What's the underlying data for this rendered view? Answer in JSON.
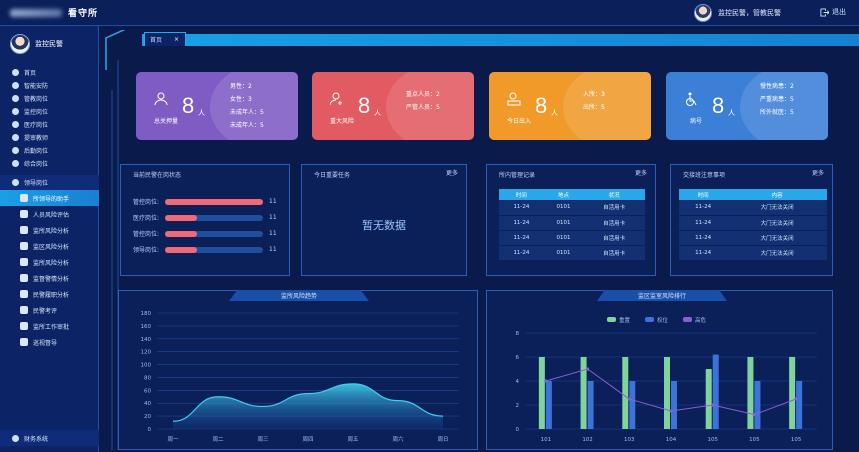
{
  "header": {
    "app_title": "看守所",
    "welcome": "监控民警，管教民警",
    "logout_label": "退出"
  },
  "sidebar": {
    "user_name": "监控民警",
    "items": [
      {
        "label": "首页"
      },
      {
        "label": "智能安防"
      },
      {
        "label": "管教岗位"
      },
      {
        "label": "监控岗位"
      },
      {
        "label": "医疗岗位"
      },
      {
        "label": "提审教师"
      },
      {
        "label": "后勤岗位"
      },
      {
        "label": "综合岗位"
      }
    ],
    "group_label": "领导岗位",
    "sub_items": [
      {
        "label": "所领导的助手",
        "active": true
      },
      {
        "label": "人员风险评估"
      },
      {
        "label": "监所风险分析"
      },
      {
        "label": "监区风险分析"
      },
      {
        "label": "监所风险分析"
      },
      {
        "label": "监督警情分析"
      },
      {
        "label": "民警履职分析"
      },
      {
        "label": "民警考评"
      },
      {
        "label": "监所工作审批"
      },
      {
        "label": "巡视督导"
      }
    ],
    "bottom_label": "财务系统"
  },
  "tabs": [
    {
      "label": "首页"
    }
  ],
  "cards": [
    {
      "label": "总关押量",
      "value": "8",
      "unit": "人",
      "color": "#7e5cc4",
      "details": [
        "男性：2",
        "女性：3",
        "未成年人：5",
        "未成年人：5"
      ]
    },
    {
      "label": "重大风险",
      "value": "8",
      "unit": "人",
      "color": "#e25b62",
      "details": [
        "重点人员：2",
        "严管人员：5"
      ]
    },
    {
      "label": "今日出入",
      "value": "8",
      "unit": "人",
      "color": "#f19a2a",
      "details": [
        "入所：3",
        "出所：5"
      ]
    },
    {
      "label": "病号",
      "value": "8",
      "unit": "人",
      "color": "#3b7fd6",
      "details": [
        "慢性病患：2",
        "严重病患：5",
        "所外就医：5"
      ]
    }
  ],
  "posts_panel": {
    "title": "当前民警在岗状态",
    "rows": [
      {
        "label": "管控岗位:",
        "value": "11",
        "fill": 1.0
      },
      {
        "label": "医疗岗位:",
        "value": "11",
        "fill": 0.33
      },
      {
        "label": "管控岗位:",
        "value": "11",
        "fill": 0.33
      },
      {
        "label": "领导岗位:",
        "value": "11",
        "fill": 0.33
      }
    ]
  },
  "tasks_panel": {
    "title": "今日重要任务",
    "more": "更多",
    "empty_text": "暂无数据"
  },
  "records_panel": {
    "title": "所内管理记录",
    "more": "更多",
    "columns": [
      "时间",
      "地点",
      "状况"
    ],
    "rows": [
      [
        "11-24",
        "0101",
        "自活用卡"
      ],
      [
        "11-24",
        "0101",
        "自活用卡"
      ],
      [
        "11-24",
        "0101",
        "自活用卡"
      ],
      [
        "11-24",
        "0101",
        "自活用卡"
      ]
    ]
  },
  "handover_panel": {
    "title": "交接班注意事项",
    "more": "更多",
    "columns": [
      "时间",
      "内容"
    ],
    "rows": [
      [
        "11-24",
        "大门无法关闭"
      ],
      [
        "11-24",
        "大门无法关闭"
      ],
      [
        "11-24",
        "大门无法关闭"
      ],
      [
        "11-24",
        "大门无法关闭"
      ]
    ]
  },
  "chart_data": [
    {
      "type": "area",
      "title": "监所风险趋势",
      "categories": [
        "周一",
        "周二",
        "周三",
        "周四",
        "周五",
        "周六",
        "周日"
      ],
      "values": [
        12,
        50,
        35,
        55,
        70,
        44,
        20
      ],
      "ylim": [
        0,
        180
      ],
      "yticks": [
        0,
        20,
        40,
        60,
        80,
        100,
        120,
        140,
        160,
        180
      ],
      "color": "#3fd0e8",
      "grid": true
    },
    {
      "type": "bar",
      "title": "监区监室风险排行",
      "categories": [
        "101",
        "102",
        "103",
        "104",
        "105",
        "105",
        "105"
      ],
      "ylim": [
        0,
        8
      ],
      "yticks": [
        0,
        2,
        4,
        6,
        8
      ],
      "legend": [
        "重置",
        "权位",
        "高危"
      ],
      "legend_position": "top",
      "series": [
        {
          "name": "重置",
          "kind": "bar",
          "color": "#7ed49a",
          "values": [
            6,
            6,
            6,
            6,
            5,
            6,
            6
          ]
        },
        {
          "name": "权位",
          "kind": "bar",
          "color": "#3d73d8",
          "values": [
            4,
            4,
            4,
            4,
            6.2,
            4,
            4
          ]
        },
        {
          "name": "高危",
          "kind": "line",
          "color": "#8a5fd0",
          "values": [
            4,
            5,
            2.5,
            1.5,
            2,
            1.2,
            2.5
          ]
        }
      ]
    }
  ]
}
